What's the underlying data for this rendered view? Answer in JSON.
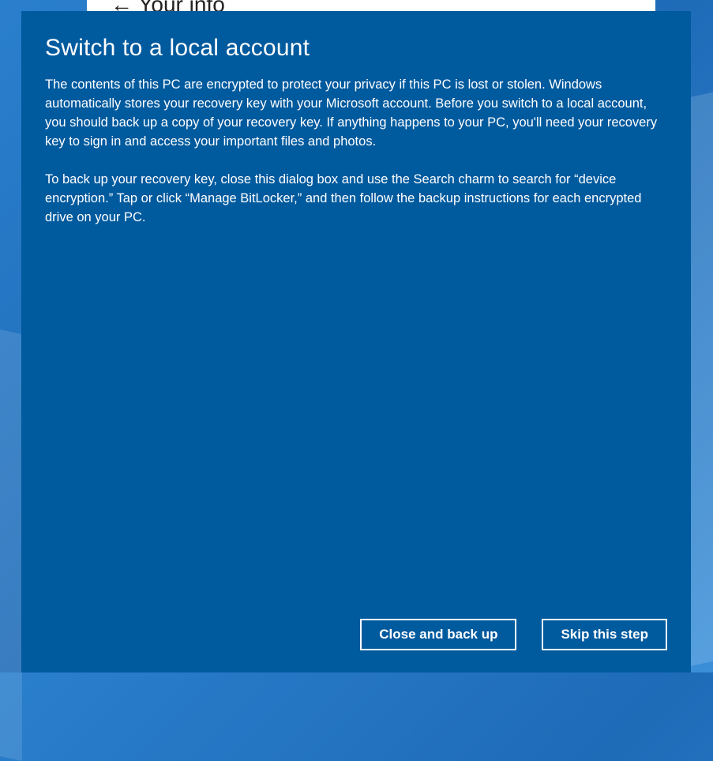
{
  "background": {
    "partial_text_visible": "←   Your info"
  },
  "dialog": {
    "title": "Switch to a local account",
    "paragraph1": "The contents of this PC are encrypted to protect your privacy if this PC is lost or stolen. Windows automatically stores your recovery key with your Microsoft account. Before you switch to a local account, you should back up a copy of your recovery key. If anything happens to your PC, you'll need your recovery key to sign in and access your important files and photos.",
    "paragraph2": "To back up your recovery key, close this dialog box and use the Search charm to search for “device encryption.” Tap or click “Manage BitLocker,” and then follow the backup instructions for each encrypted drive on your PC.",
    "buttons": {
      "close_and_back_up": "Close and back up",
      "skip_this_step": "Skip this step"
    }
  }
}
